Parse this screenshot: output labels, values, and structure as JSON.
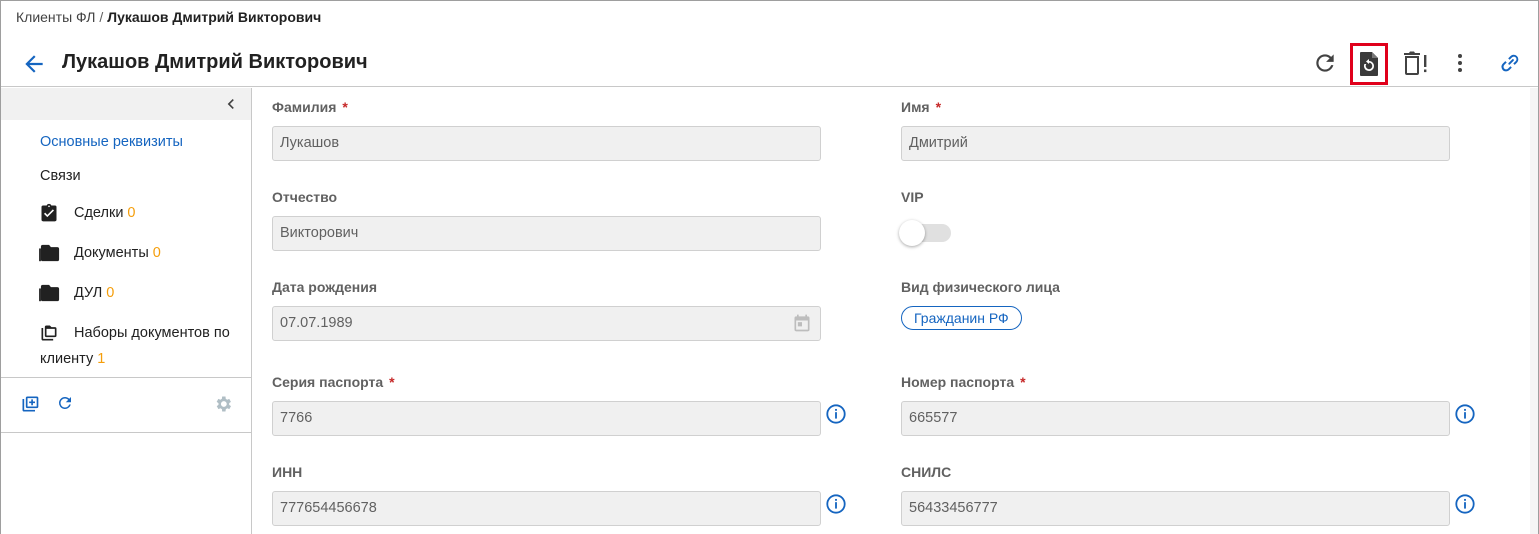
{
  "breadcrumb": {
    "parent": "Клиенты ФЛ",
    "separator": "/",
    "current": "Лукашов Дмитрий Викторович"
  },
  "header": {
    "title": "Лукашов Дмитрий Викторович",
    "icons": [
      "back-arrow-icon",
      "refresh-icon",
      "restore-document-icon",
      "delete-warning-icon",
      "more-vert-icon",
      "link-icon"
    ]
  },
  "sidebar": {
    "items": [
      {
        "label": "Основные реквизиты",
        "count": "",
        "active": true
      },
      {
        "label": "Связи",
        "count": ""
      },
      {
        "label": "Сделки",
        "count": "0",
        "icon": "clipboard-check-icon"
      },
      {
        "label": "Документы",
        "count": "0",
        "icon": "folder-icon"
      },
      {
        "label": "ДУЛ",
        "count": "0",
        "icon": "folder-icon"
      },
      {
        "label": "Наборы документов по",
        "label2": "клиенту",
        "count": "1",
        "icon": "folder-copy-icon"
      }
    ],
    "bottom_icons": [
      "add-folder-icon",
      "refresh-icon",
      "settings-icon"
    ]
  },
  "form": {
    "last_name": {
      "label": "Фамилия",
      "required": "*",
      "value": "Лукашов"
    },
    "first_name": {
      "label": "Имя",
      "required": "*",
      "value": "Дмитрий"
    },
    "patronymic": {
      "label": "Отчество",
      "value": "Викторович"
    },
    "vip": {
      "label": "VIP",
      "checked": false
    },
    "birth_date": {
      "label": "Дата рождения",
      "value": "07.07.1989"
    },
    "person_type": {
      "label": "Вид физического лица",
      "value": "Гражданин РФ"
    },
    "passport_series": {
      "label": "Серия паспорта",
      "required": "*",
      "value": "7766"
    },
    "passport_number": {
      "label": "Номер паспорта",
      "required": "*",
      "value": "665577"
    },
    "inn": {
      "label": "ИНН",
      "value": "777654456678"
    },
    "snils": {
      "label": "СНИЛС",
      "value": "56433456777"
    }
  },
  "colors": {
    "accent": "#1565c0",
    "count": "#f59e0b",
    "required": "#c62828",
    "highlight": "#e0001b"
  }
}
